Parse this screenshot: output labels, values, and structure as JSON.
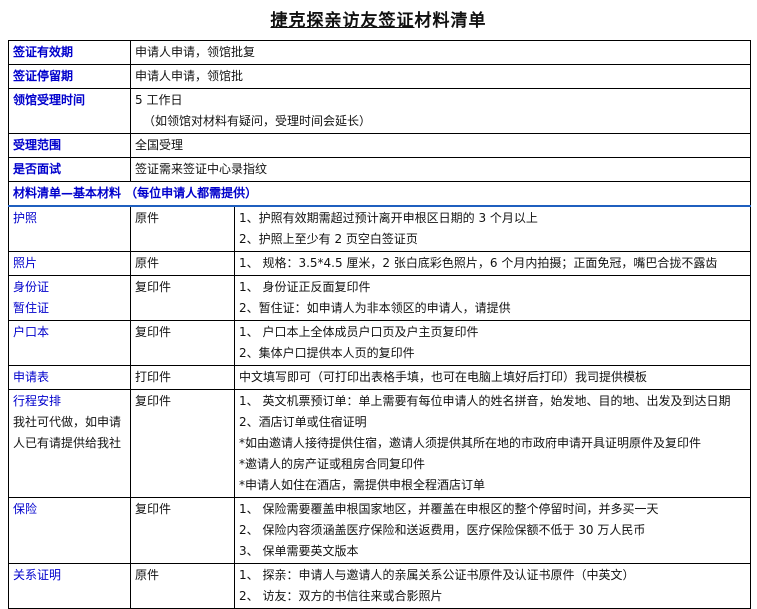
{
  "title_part1": "捷克探亲访友签证",
  "title_part2": "材料清单",
  "info_rows": [
    {
      "label": "签证有效期",
      "value": [
        "申请人申请，领馆批复"
      ]
    },
    {
      "label": "签证停留期",
      "value": [
        "申请人申请，领馆批"
      ]
    },
    {
      "label": "领馆受理时间",
      "value": [
        "5 工作日",
        "（如领馆对材料有疑问，受理时间会延长）"
      ]
    },
    {
      "label": "受理范围",
      "value": [
        "全国受理"
      ]
    },
    {
      "label": "是否面试",
      "value": [
        "签证需来签证中心录指纹"
      ]
    }
  ],
  "section_header": "材料清单—基本材料 （每位申请人都需提供）",
  "materials": [
    {
      "name": [
        "护照"
      ],
      "type": "原件",
      "details": [
        "1、护照有效期需超过预计离开申根区日期的 3 个月以上",
        "2、护照上至少有 2 页空白签证页"
      ]
    },
    {
      "name": [
        "照片"
      ],
      "type": "原件",
      "details": [
        "1、 规格：3.5*4.5 厘米，2 张白底彩色照片，6 个月内拍摄；正面免冠，嘴巴合拢不露齿"
      ]
    },
    {
      "name": [
        "身份证",
        "暂住证"
      ],
      "type": "复印件",
      "details": [
        "1、   身份证正反面复印件",
        "2、暂住证：如申请人为非本领区的申请人，请提供"
      ]
    },
    {
      "name": [
        "户口本"
      ],
      "type": "复印件",
      "details": [
        "1、  户口本上全体成员户口页及户主页复印件",
        "2、集体户口提供本人页的复印件"
      ]
    },
    {
      "name": [
        "申请表"
      ],
      "type": "打印件",
      "details": [
        "中文填写即可（可打印出表格手填，也可在电脑上填好后打印）我司提供模板"
      ]
    },
    {
      "name": [
        "行程安排",
        "我社可代做，如申请",
        "人已有请提供给我社"
      ],
      "type": "复印件",
      "details": [
        "1、  英文机票预订单：单上需要有每位申请人的姓名拼音，始发地、目的地、出发及到达日期",
        "2、酒店订单或住宿证明",
        "*如由邀请人接待提供住宿，邀请人须提供其所在地的市政府申请开具证明原件及复印件",
        "*邀请人的房产证或租房合同复印件",
        "*申请人如住在酒店，需提供申根全程酒店订单"
      ]
    },
    {
      "name": [
        "保险"
      ],
      "type": "复印件",
      "details": [
        "1、  保险需要覆盖申根国家地区，并覆盖在申根区的整个停留时间，并多买一天",
        "2、  保险内容须涵盖医疗保险和送返费用，医疗保险保额不低于 30 万人民币",
        "3、  保单需要英文版本"
      ]
    },
    {
      "name": [
        "关系证明"
      ],
      "type": "原件",
      "details": [
        "1、  探亲：申请人与邀请人的亲属关系公证书原件及认证书原件（中英文）",
        "2、  访友：双方的书信往来或合影照片"
      ]
    }
  ]
}
